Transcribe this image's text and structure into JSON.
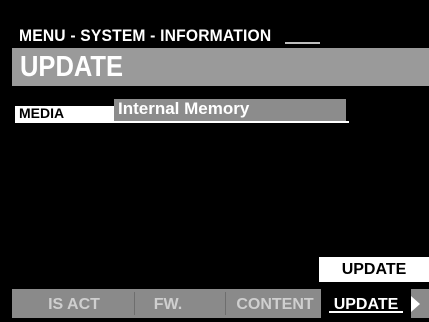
{
  "header": {
    "breadcrumb": "MENU - SYSTEM - INFORMATION",
    "title": "UPDATE"
  },
  "param": {
    "label": "MEDIA",
    "value": "Internal Memory"
  },
  "action": {
    "label": "UPDATE"
  },
  "tabs": [
    {
      "label": "IS ACT",
      "active": false
    },
    {
      "label": "FW.",
      "active": false
    },
    {
      "label": "CONTENT",
      "active": false
    },
    {
      "label": "UPDATE",
      "active": true
    }
  ],
  "next_icon": "triangle-right-icon",
  "colors": {
    "background": "#000000",
    "title_bar": "#9a9a9a",
    "value_box": "#8c8c8c",
    "tab_bar": "#8a8a8a",
    "text": "#ffffff"
  }
}
